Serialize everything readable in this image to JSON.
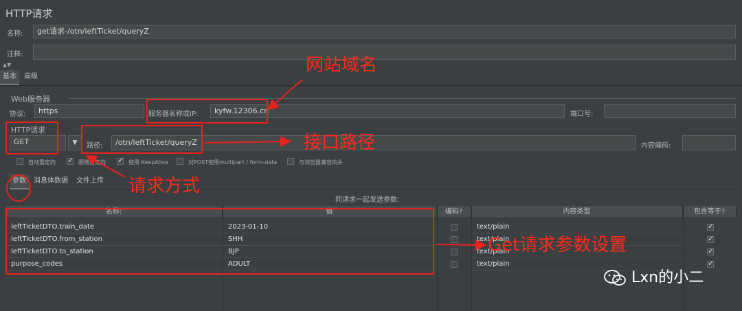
{
  "window": {
    "title": "HTTP请求"
  },
  "header": {
    "name_label": "名称:",
    "name_value": "get请求-/otn/leftTicket/queryZ",
    "comment_label": "注释:",
    "comment_value": ""
  },
  "top_tabs": [
    {
      "label": "基本"
    },
    {
      "label": "高级"
    }
  ],
  "web_server": {
    "group_label": "Web服务器",
    "protocol_label": "协议:",
    "protocol_value": "https",
    "server_label": "服务器名称或IP:",
    "server_value": "kyfw.12306.cn",
    "port_label": "端口号:",
    "port_value": ""
  },
  "http_request": {
    "group_label": "HTTP请求",
    "method_value": "GET",
    "path_label": "路径:",
    "path_value": "/otn/leftTicket/queryZ",
    "encoding_label": "内容编码:",
    "encoding_value": ""
  },
  "options": [
    {
      "label": "自动重定向",
      "checked": false
    },
    {
      "label": "跟随重定向",
      "checked": true
    },
    {
      "label": "使用 KeepAlive",
      "checked": true
    },
    {
      "label": "对POST使用multipart / form-data",
      "checked": false
    },
    {
      "label": "与浏览器兼容的头",
      "checked": false
    }
  ],
  "param_tabs": [
    {
      "label": "参数"
    },
    {
      "label": "消息体数据"
    },
    {
      "label": "文件上传"
    }
  ],
  "params": {
    "caption": "同请求一起发送参数:",
    "columns": [
      "名称:",
      "值",
      "编码?",
      "内容类型",
      "包含等于?"
    ],
    "rows": [
      {
        "name": "leftTicketDTO.train_date",
        "value": "2023-01-10",
        "encode": false,
        "content_type": "text/plain",
        "include_equals": true
      },
      {
        "name": "leftTicketDTO.from_station",
        "value": "SHH",
        "encode": false,
        "content_type": "text/plain",
        "include_equals": true
      },
      {
        "name": "leftTicketDTO.to_station",
        "value": "BJP",
        "encode": false,
        "content_type": "text/plain",
        "include_equals": true
      },
      {
        "name": "purpose_codes",
        "value": "ADULT",
        "encode": false,
        "content_type": "text/plain",
        "include_equals": true
      }
    ]
  },
  "annotations": {
    "domain": "网站域名",
    "path": "接口路径",
    "method": "请求方式",
    "params": "Get请求参数设置",
    "color": "#e8231d"
  },
  "watermark": {
    "text": "Lxn的小二",
    "icon": "wechat-icon"
  },
  "colors": {
    "background": "#3c3f41",
    "field": "#45494a",
    "annotation": "#e8231d"
  }
}
